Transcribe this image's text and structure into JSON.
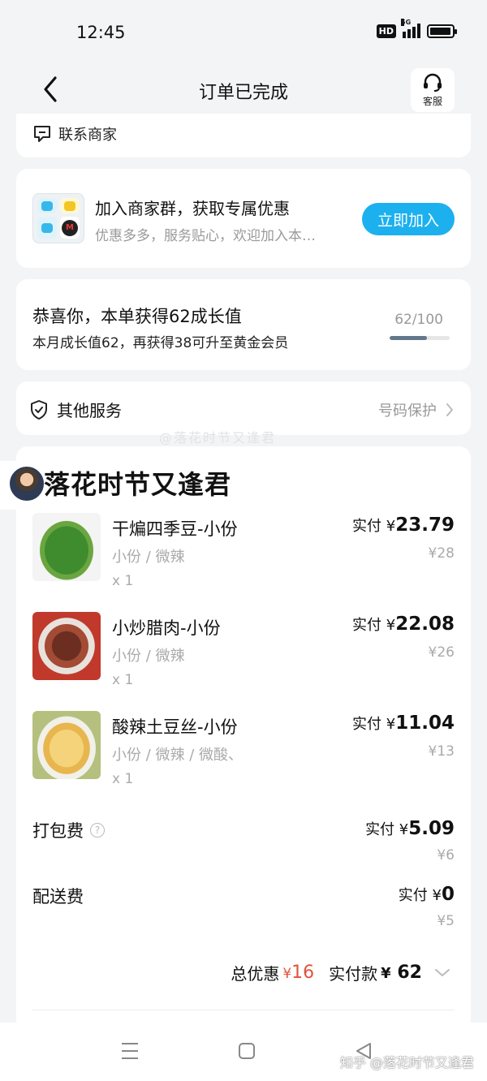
{
  "status_bar": {
    "time": "12:45",
    "hd": "HD",
    "network": "5G",
    "battery_level": 0.95
  },
  "nav": {
    "title": "订单已完成",
    "service_label": "客服"
  },
  "contact": {
    "label": "联系商家"
  },
  "group": {
    "title": "加入商家群，获取专属优惠",
    "subtitle": "优惠多多，服务贴心，欢迎加入本…",
    "join_label": "立即加入"
  },
  "growth": {
    "title": "恭喜你，本单获得62成长值",
    "subtitle": "本月成长值62，再获得38可升至黄金会员",
    "progress_text": "62/100",
    "progress": 0.62
  },
  "service": {
    "label": "其他服务",
    "right_label": "号码保护"
  },
  "watermark": {
    "faint_text": "@落花时节又逢君",
    "author": "落花时节又逢君",
    "corner": "知乎 @落花时节又逢君"
  },
  "items": [
    {
      "name": "干煸四季豆-小份",
      "spec": "小份 / 微辣",
      "qty": "x 1",
      "paid_prefix": "实付",
      "currency": "¥",
      "paid": "23.79",
      "original": "¥28"
    },
    {
      "name": "小炒腊肉-小份",
      "spec": "小份 / 微辣",
      "qty": "x 1",
      "paid_prefix": "实付",
      "currency": "¥",
      "paid": "22.08",
      "original": "¥26"
    },
    {
      "name": "酸辣土豆丝-小份",
      "spec": "小份 / 微辣 / 微酸、",
      "qty": "x 1",
      "paid_prefix": "实付",
      "currency": "¥",
      "paid": "11.04",
      "original": "¥13"
    }
  ],
  "fees": [
    {
      "label": "打包费",
      "paid_prefix": "实付",
      "currency": "¥",
      "paid": "5.09",
      "original": "¥6",
      "has_help": true
    },
    {
      "label": "配送费",
      "paid_prefix": "实付",
      "currency": "¥",
      "paid": "0",
      "original": "¥5",
      "has_help": false
    }
  ],
  "total": {
    "discount_label": "总优惠",
    "discount_currency": "¥",
    "discount": "16",
    "paid_label": "实付款",
    "currency": "¥",
    "paid": "62"
  },
  "colors": {
    "accent": "#1cb0ee",
    "discount_red": "#e0533a",
    "background": "#f3f4f6"
  }
}
